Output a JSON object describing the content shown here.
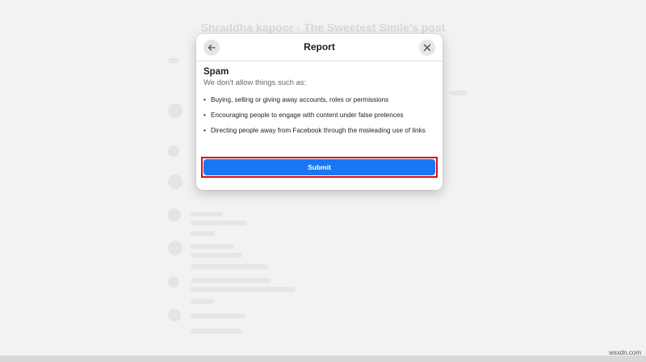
{
  "background": {
    "post_title": "Shraddha kapoor · The Sweetest Smile's post"
  },
  "dialog": {
    "title": "Report",
    "back_icon": "arrow-left-icon",
    "close_icon": "close-icon",
    "section_title": "Spam",
    "section_subtitle": "We don't allow things such as:",
    "bullets": [
      "Buying, selling or giving away accounts, roles or permissions",
      "Encouraging people to engage with content under false pretences",
      "Directing people away from Facebook through the misleading use of links"
    ],
    "submit_label": "Submit"
  },
  "watermark": "wsxdn.com",
  "colors": {
    "primary": "#1877f2",
    "highlight": "#d0101a",
    "icon_bg": "#e4e6eb"
  }
}
